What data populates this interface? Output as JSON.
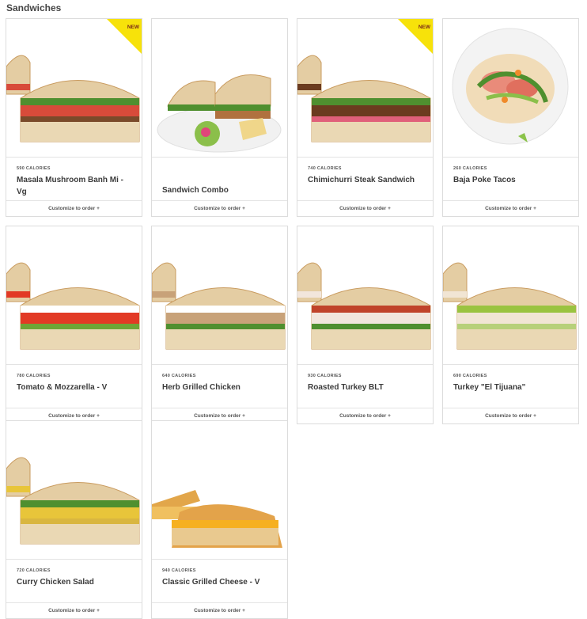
{
  "section": {
    "title": "Sandwiches"
  },
  "cta_label": "Customize to order +",
  "badge_label": "NEW",
  "items": [
    {
      "name": "Masala Mushroom Banh Mi - Vg",
      "calories": "590 CALORIES",
      "badge": "NEW"
    },
    {
      "name": "Sandwich Combo",
      "calories": "",
      "badge": ""
    },
    {
      "name": "Chimichurri Steak Sandwich",
      "calories": "740 CALORIES",
      "badge": "NEW"
    },
    {
      "name": "Baja Poke Tacos",
      "calories": "260 CALORIES",
      "badge": ""
    },
    {
      "name": "Tomato & Mozzarella - V",
      "calories": "780 CALORIES",
      "badge": ""
    },
    {
      "name": "Herb Grilled Chicken",
      "calories": "640 CALORIES",
      "badge": ""
    },
    {
      "name": "Roasted Turkey BLT",
      "calories": "930 CALORIES",
      "badge": ""
    },
    {
      "name": "Turkey \"El Tijuana\"",
      "calories": "690 CALORIES",
      "badge": ""
    },
    {
      "name": "Curry Chicken Salad",
      "calories": "720 CALORIES",
      "badge": ""
    },
    {
      "name": "Classic Grilled Cheese - V",
      "calories": "940 CALORIES",
      "badge": ""
    }
  ],
  "colors": {
    "badge": "#f7e20a",
    "bread": "#e2c9a0",
    "greens": "#5f9a3a"
  }
}
